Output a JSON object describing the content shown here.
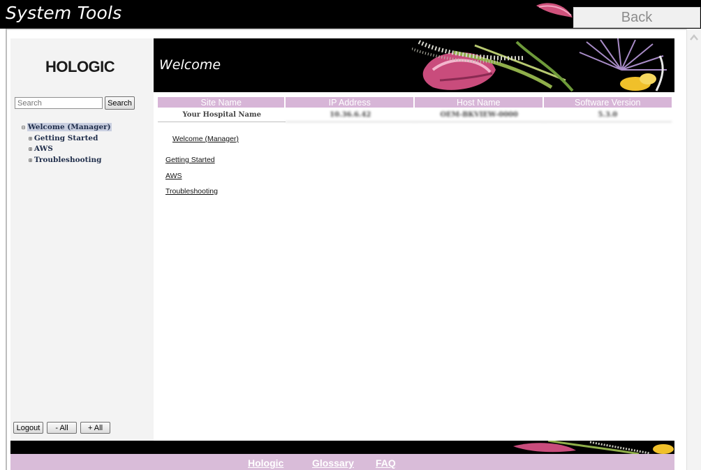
{
  "window": {
    "title": "System Tools",
    "back_label": "Back"
  },
  "sidebar": {
    "logo": "HOLOGIC",
    "search_placeholder": "Search",
    "search_button": "Search",
    "tree": [
      {
        "label": "Welcome (Manager)",
        "expander": "⊟",
        "selected": true
      },
      {
        "label": "Getting Started",
        "expander": "⊞"
      },
      {
        "label": "AWS",
        "expander": "⊞"
      },
      {
        "label": "Troubleshooting",
        "expander": "⊞"
      }
    ],
    "logout_label": "Logout",
    "collapse_all_label": "- All",
    "expand_all_label": "+ All"
  },
  "banner": {
    "title": "Welcome"
  },
  "info_table": {
    "headers": [
      "Site Name",
      "IP Address",
      "Host Name",
      "Software Version"
    ],
    "row": {
      "site_name": "Your Hospital Name",
      "ip_address": "10.36.6.42",
      "host_name": "OEM-BKVIEW-0000",
      "software_version": "5.3.0"
    }
  },
  "main_links": {
    "welcome": "Welcome (Manager)",
    "getting_started": "Getting Started",
    "aws": "AWS",
    "troubleshooting": "Troubleshooting"
  },
  "footer": {
    "links": [
      "Hologic",
      "Glossary",
      "FAQ"
    ]
  },
  "colors": {
    "header_bg": "#000000",
    "table_header": "#d7b5d7",
    "footer_bar": "#d9bcd9",
    "tree_selected": "#c9cfe0"
  },
  "icons": {
    "scroll_up": "chevron-up-icon",
    "tree_expand": "plus-box-icon",
    "tree_collapse": "minus-box-icon"
  }
}
